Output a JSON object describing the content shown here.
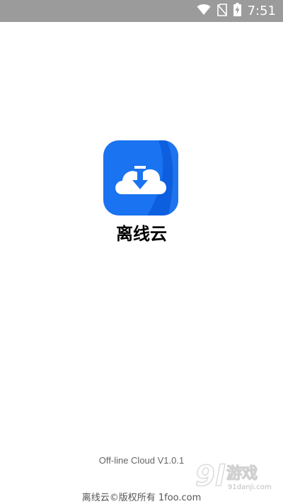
{
  "status_bar": {
    "time": "7:51",
    "icons": [
      "wifi-icon",
      "no-sim-icon",
      "battery-charging-icon"
    ]
  },
  "app": {
    "name": "离线云",
    "icon": "cloud-download-icon",
    "version": "Off-line Cloud V1.0.1",
    "copyright": "离线云©版权所有 1foo.com"
  },
  "watermark": {
    "logo_text": "91游戏",
    "site": "91danji.com"
  },
  "colors": {
    "status_bar_bg": "#9b9b9b",
    "icon_blue": "#1a73f0",
    "background": "#ffffff"
  }
}
